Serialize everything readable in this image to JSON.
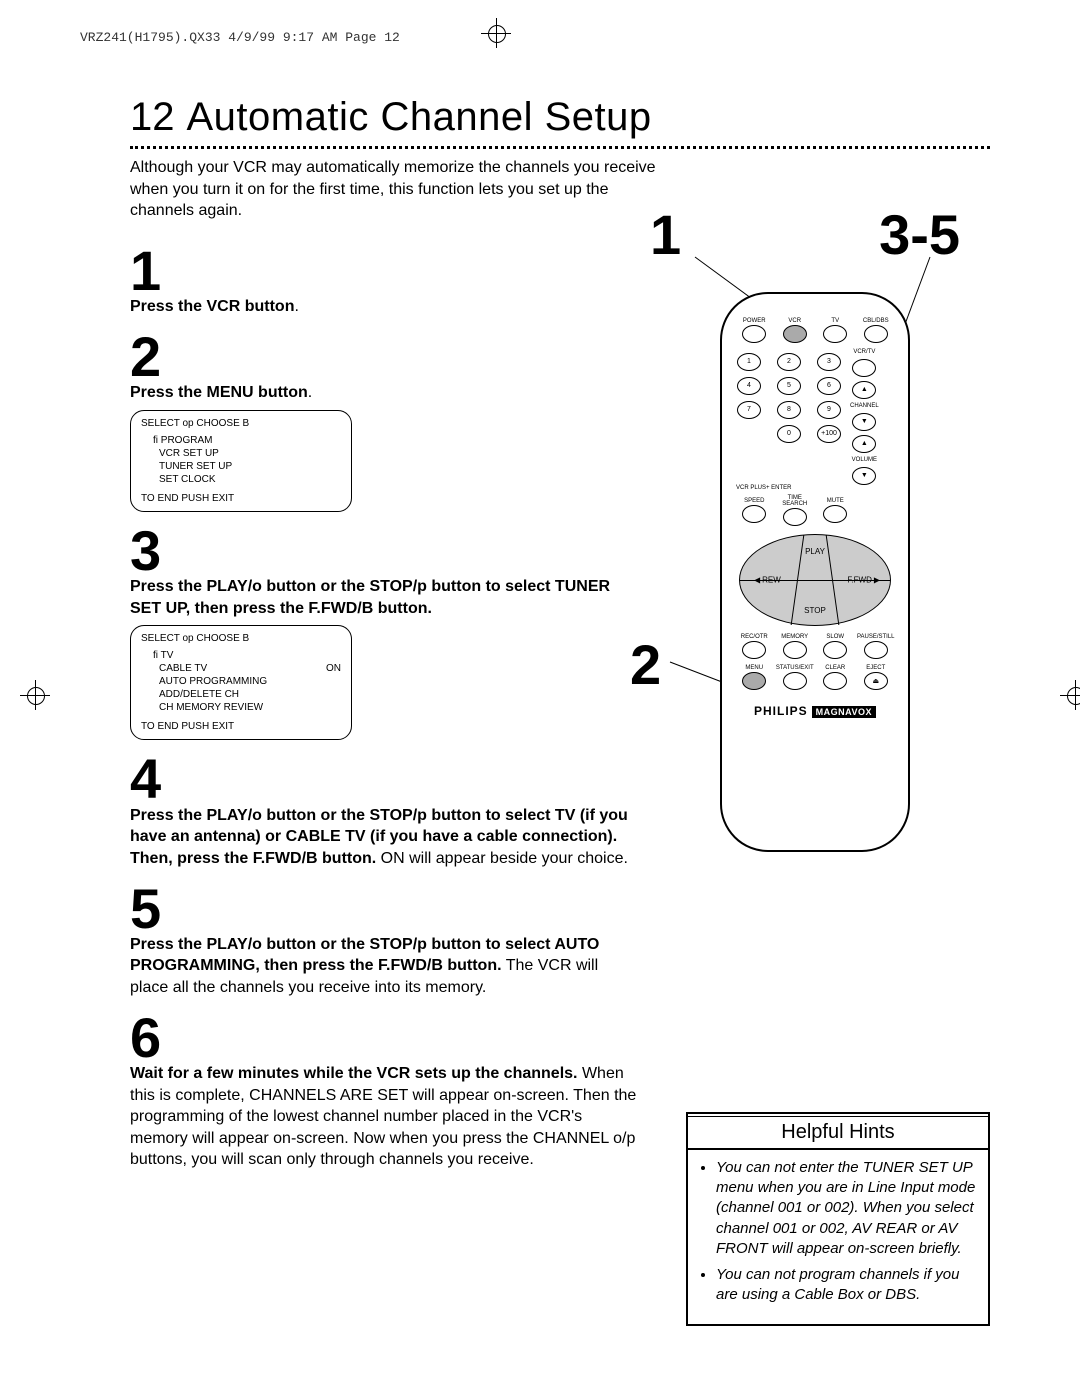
{
  "header": "VRZ241(H1795).QX33  4/9/99 9:17 AM  Page 12",
  "page_number": "12",
  "title": "Automatic Channel Setup",
  "intro": "Although your VCR may automatically memorize the channels you receive when you turn it on for the first time, this function lets you set up the channels again.",
  "callouts": {
    "top_left": "1",
    "top_right": "3-5",
    "side": "2"
  },
  "steps": [
    {
      "num": "1",
      "bold": "Press the VCR button",
      "tail": "."
    },
    {
      "num": "2",
      "bold": "Press the MENU button",
      "tail": "."
    },
    {
      "num": "3",
      "bold": "Press the PLAY/o button or the STOP/p button to select TUNER SET UP, then press the F.FWD/B button."
    },
    {
      "num": "4",
      "bold": "Press the PLAY/o button or the STOP/p button to select TV (if you have an antenna) or CABLE TV (if you have a cable connection). Then, press the F.FWD/B button.",
      "after": "ON will appear beside your choice."
    },
    {
      "num": "5",
      "bold": "Press the PLAY/o button or the STOP/p button to select AUTO PROGRAMMING, then press the F.FWD/B button.",
      "after": "The VCR will place all the channels you receive into its memory."
    },
    {
      "num": "6",
      "bold": "Wait for a few minutes while the VCR sets up the channels.",
      "after": "When this is complete, CHANNELS ARE SET will appear on-screen. Then the programming of the lowest channel number placed in the VCR's memory will appear on-screen. Now when you press the CHANNEL o/p buttons, you will scan only through channels you receive."
    }
  ],
  "screen1": {
    "header": "SELECT op   CHOOSE B",
    "lines": [
      "fi PROGRAM",
      "VCR SET UP",
      "TUNER SET UP",
      "SET CLOCK"
    ],
    "footer": "TO END PUSH EXIT"
  },
  "screen2": {
    "header": "SELECT op   CHOOSE B",
    "line1_left": "fi TV",
    "line1_right": "",
    "line2_left": "CABLE TV",
    "line2_right": "ON",
    "lines": [
      "AUTO PROGRAMMING",
      "ADD/DELETE CH",
      "CH MEMORY REVIEW"
    ],
    "footer": "TO END PUSH EXIT"
  },
  "remote": {
    "row1": [
      "POWER",
      "VCR",
      "TV",
      "CBL/DBS"
    ],
    "vcrtv": "VCR/TV",
    "numbers": [
      "1",
      "2",
      "3",
      "4",
      "5",
      "6",
      "7",
      "8",
      "9",
      "0",
      "+100"
    ],
    "channel": "CHANNEL",
    "volume": "VOLUME",
    "vcrplus": "VCR PLUS+ ENTER",
    "row_mid": [
      "SPEED",
      "TIME SEARCH",
      "MUTE"
    ],
    "play": "PLAY",
    "stop": "STOP",
    "rew": "REW",
    "ffwd": "F.FWD",
    "row_rec": [
      "REC/OTR",
      "MEMORY",
      "SLOW",
      "PAUSE/STILL"
    ],
    "row_bot": [
      "MENU",
      "STATUS/EXIT",
      "CLEAR",
      "EJECT"
    ],
    "brand": "PHILIPS",
    "brand2": "MAGNAVOX"
  },
  "hints": {
    "title": "Helpful Hints",
    "items": [
      "You can not enter the TUNER SET UP menu when you are in Line Input mode (channel 001 or 002). When you select channel 001 or 002, AV REAR or AV FRONT will appear on-screen briefly.",
      "You can not program channels if you are using a Cable Box or DBS."
    ]
  }
}
